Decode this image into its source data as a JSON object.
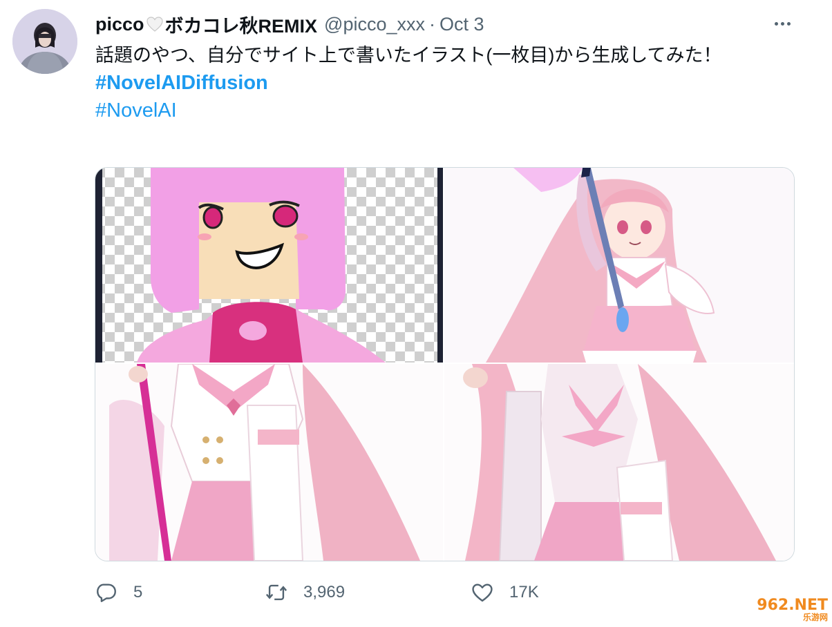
{
  "tweet": {
    "display_name": "picco",
    "display_name_suffix": "ボカコレ秋REMIX",
    "handle": "@picco_xxx",
    "separator": "·",
    "date": "Oct 3",
    "text": "話題のやつ、自分でサイト上で書いたイラスト(一枚目)から生成してみた！",
    "hashtags": [
      "#NovelAIDiffusion",
      "#NovelAI"
    ]
  },
  "actions": {
    "reply_count": "5",
    "retweet_count": "3,969",
    "like_count": "17K"
  },
  "watermark": {
    "brand": "962.NET",
    "sub": "乐游网"
  },
  "icons": {
    "heart_emoji": "white-heart-icon",
    "more": "more-options-icon",
    "reply": "reply-icon",
    "retweet": "retweet-icon",
    "like": "like-icon"
  },
  "colors": {
    "text": "#0f1419",
    "muted": "#536471",
    "link": "#1d9bf0",
    "border": "#cfd9de"
  }
}
